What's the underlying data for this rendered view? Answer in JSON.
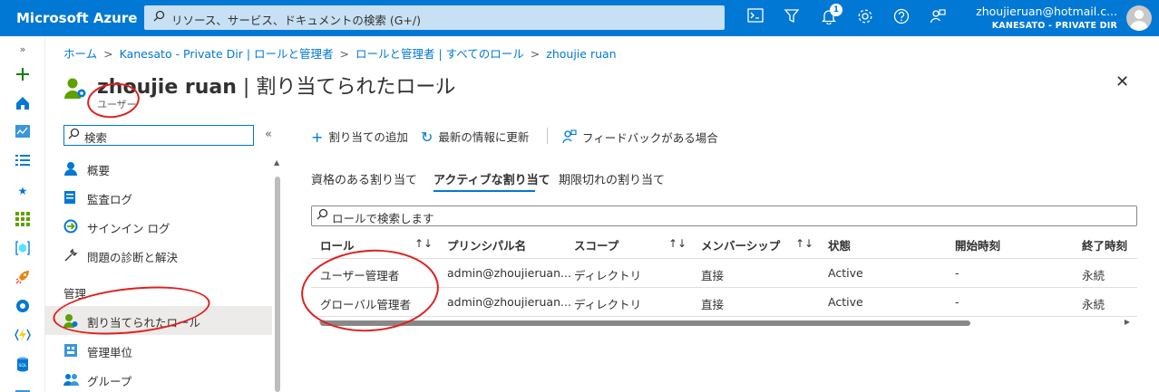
{
  "topbar": {
    "brand": "Microsoft Azure",
    "search_placeholder": "リソース、サービス、ドキュメントの検索 (G+/)",
    "notification_count": "1",
    "account_email": "zhoujieruan@hotmail.c...",
    "account_directory": "KANESATO - PRIVATE DIR"
  },
  "breadcrumb": [
    "ホーム",
    "Kanesato - Private Dir | ロールと管理者",
    "ロールと管理者 | すべてのロール",
    "zhoujie ruan"
  ],
  "page": {
    "title_name": "zhoujie ruan",
    "title_rest": " | 割り当てられたロール",
    "subtitle": "ユーザー",
    "more": "…",
    "close": "✕"
  },
  "menu": {
    "search_placeholder": "検索",
    "collapse": "«",
    "items": [
      {
        "label": "概要",
        "icon": "user-icon"
      },
      {
        "label": "監査ログ",
        "icon": "log-icon"
      },
      {
        "label": "サインイン ログ",
        "icon": "signin-icon"
      },
      {
        "label": "問題の診断と解決",
        "icon": "wrench-icon"
      }
    ],
    "section": "管理",
    "manage_items": [
      {
        "label": "割り当てられたロール",
        "icon": "assigned-roles-icon",
        "selected": true
      },
      {
        "label": "管理単位",
        "icon": "admin-units-icon"
      },
      {
        "label": "グループ",
        "icon": "groups-icon"
      }
    ]
  },
  "commands": {
    "add": "割り当ての追加",
    "refresh": "最新の情報に更新",
    "feedback": "フィードバックがある場合"
  },
  "tabs": [
    "資格のある割り当て",
    "アクティブな割り当て",
    "期限切れの割り当て"
  ],
  "filter_placeholder": "ロールで検索します",
  "table": {
    "columns": [
      "ロール",
      "プリンシパル名",
      "スコープ",
      "メンバーシップ",
      "状態",
      "開始時刻",
      "終了時刻"
    ],
    "rows": [
      [
        "ユーザー管理者",
        "admin@zhoujieruan...",
        "ディレクトリ",
        "直接",
        "Active",
        "-",
        "永続"
      ],
      [
        "グローバル管理者",
        "admin@zhoujieruan...",
        "ディレクトリ",
        "直接",
        "Active",
        "-",
        "永続"
      ]
    ]
  },
  "colors": {
    "accent": "#0078d4",
    "annotation": "#e02020"
  }
}
